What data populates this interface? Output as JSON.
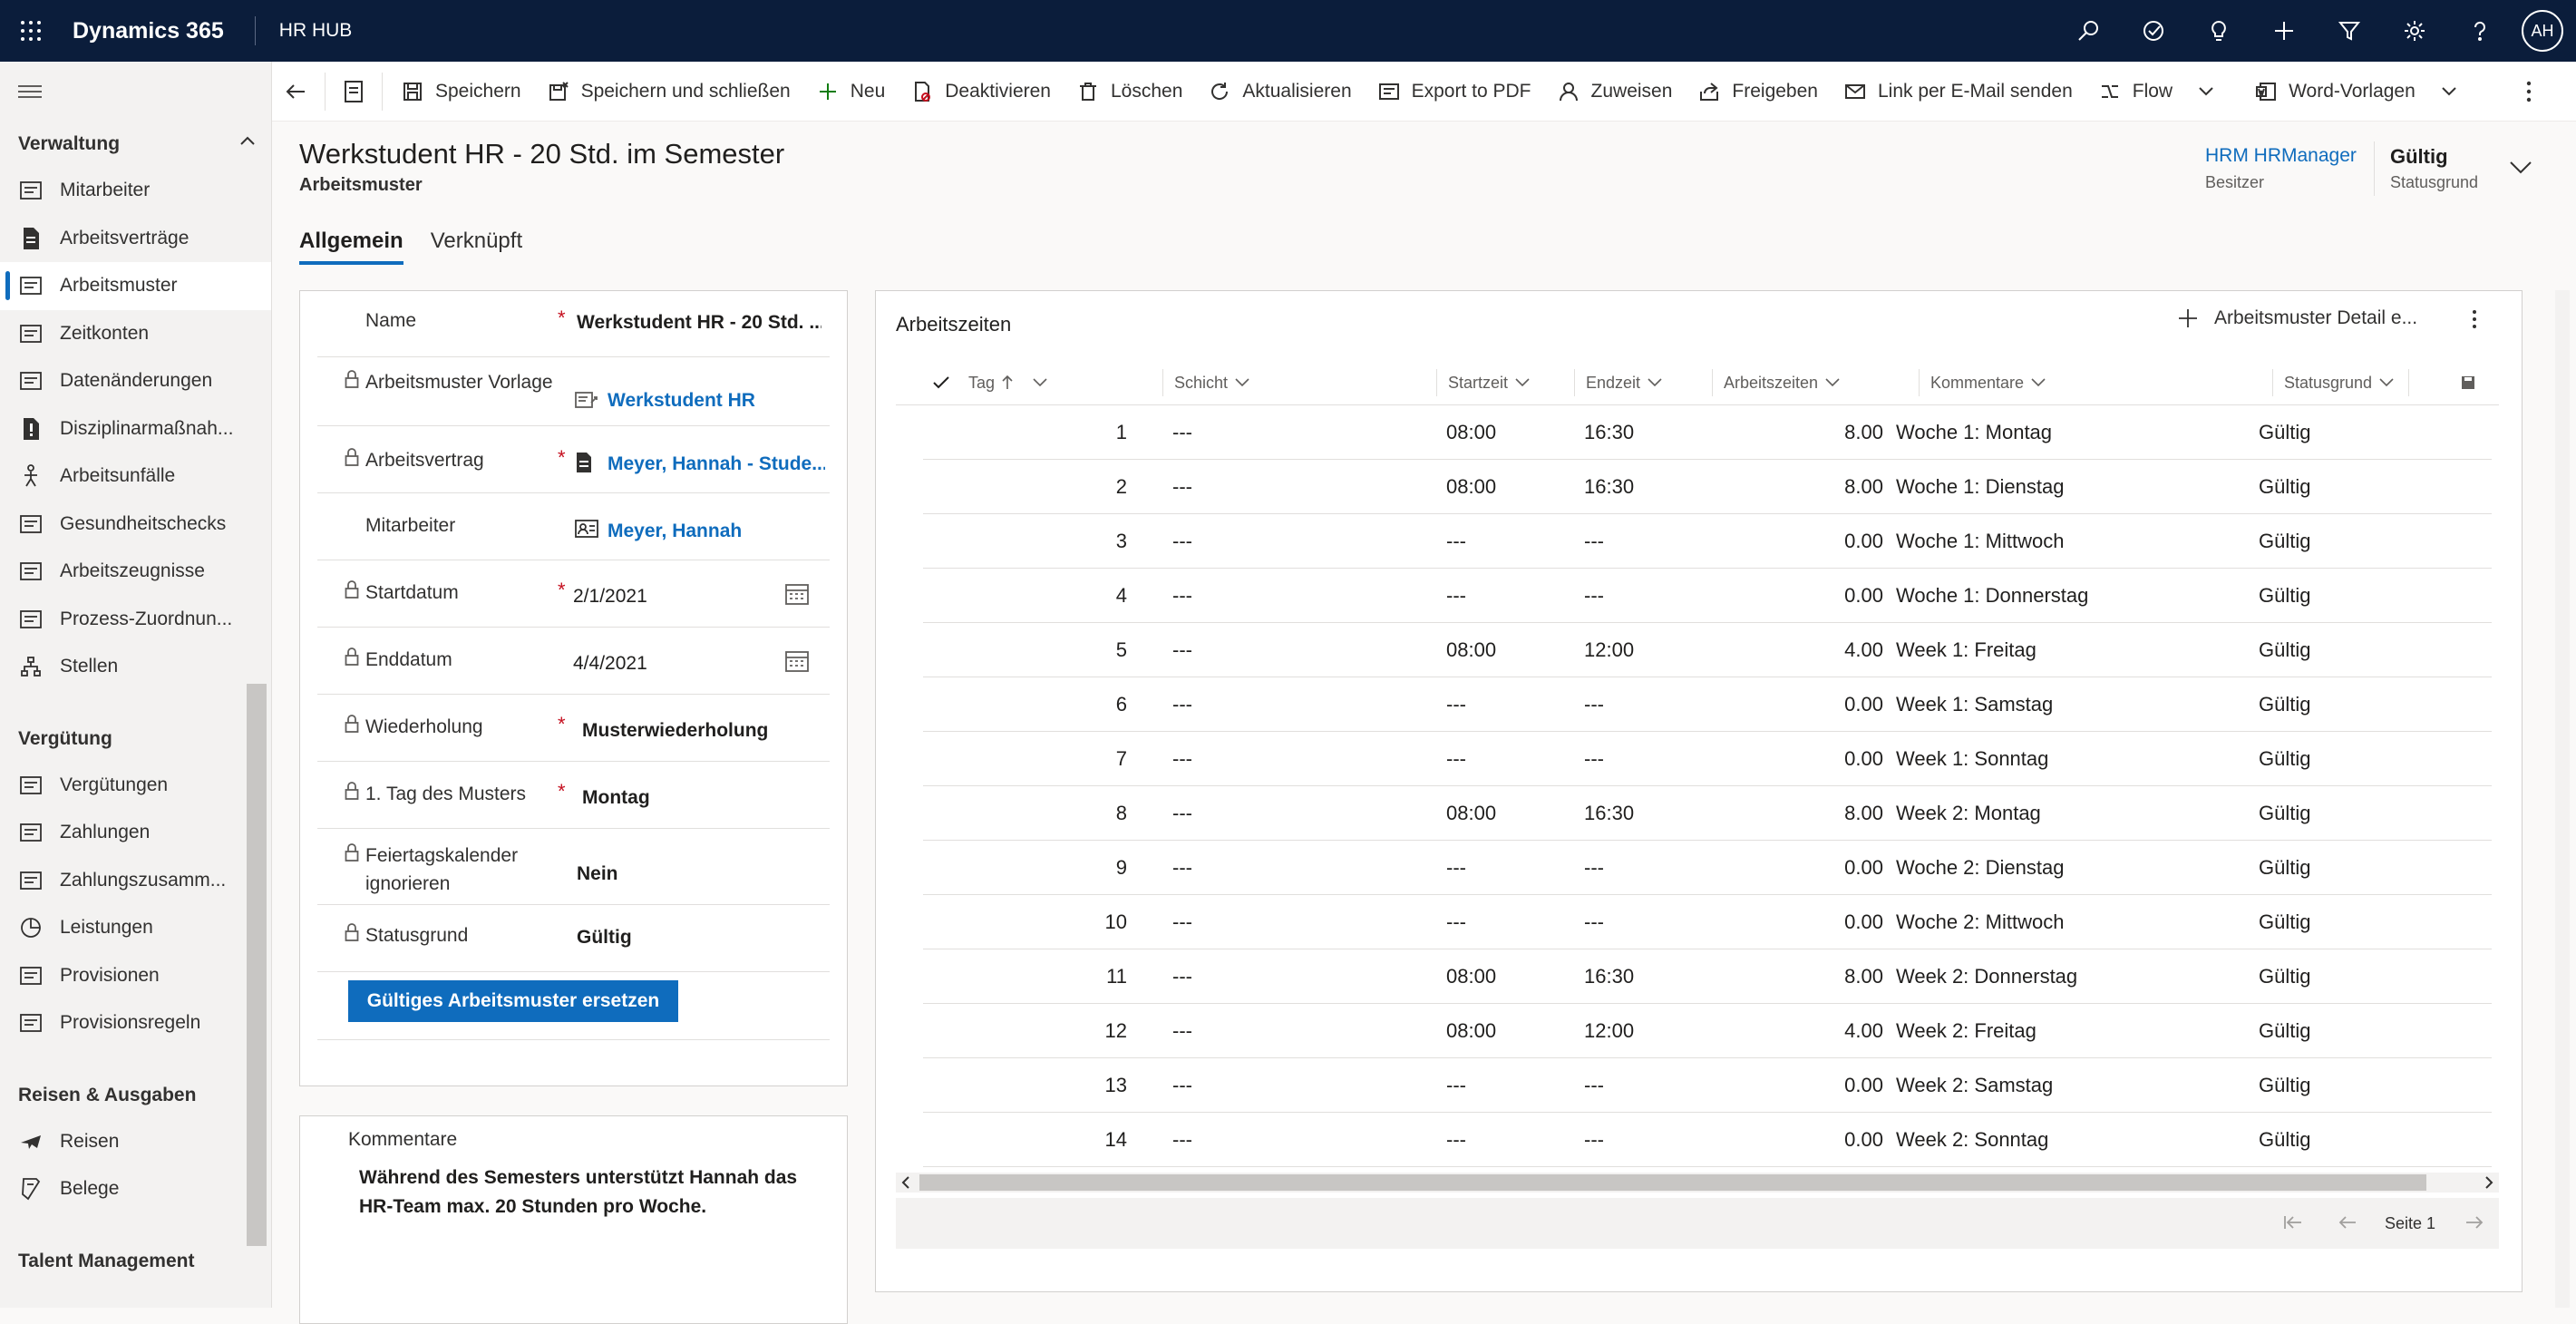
{
  "topbar": {
    "brand": "Dynamics 365",
    "app": "HR HUB",
    "avatar": "AH",
    "icons": [
      "search-icon",
      "task-icon",
      "lightbulb-icon",
      "plus-icon",
      "filter-icon",
      "gear-icon",
      "help-icon"
    ]
  },
  "sidebar": {
    "groups": [
      {
        "label": "Verwaltung",
        "items": [
          {
            "label": "Mitarbeiter",
            "icon": "contact-card-icon"
          },
          {
            "label": "Arbeitsverträge",
            "icon": "document-icon"
          },
          {
            "label": "Arbeitsmuster",
            "icon": "calendar-pattern-icon",
            "active": true
          },
          {
            "label": "Zeitkonten",
            "icon": "time-account-icon"
          },
          {
            "label": "Datenänderungen",
            "icon": "data-change-icon"
          },
          {
            "label": "Disziplinarmaßnah...",
            "icon": "alert-icon"
          },
          {
            "label": "Arbeitsunfälle",
            "icon": "accident-icon"
          },
          {
            "label": "Gesundheitschecks",
            "icon": "health-icon"
          },
          {
            "label": "Arbeitszeugnisse",
            "icon": "certificate-icon"
          },
          {
            "label": "Prozess-Zuordnun...",
            "icon": "process-icon"
          },
          {
            "label": "Stellen",
            "icon": "org-icon"
          }
        ]
      },
      {
        "label": "Vergütung",
        "items": [
          {
            "label": "Vergütungen",
            "icon": "money-icon"
          },
          {
            "label": "Zahlungen",
            "icon": "payment-icon"
          },
          {
            "label": "Zahlungszusamm...",
            "icon": "payment-summary-icon"
          },
          {
            "label": "Leistungen",
            "icon": "pie-icon"
          },
          {
            "label": "Provisionen",
            "icon": "commission-icon"
          },
          {
            "label": "Provisionsregeln",
            "icon": "rules-icon"
          }
        ]
      },
      {
        "label": "Reisen & Ausgaben",
        "items": [
          {
            "label": "Reisen",
            "icon": "plane-icon"
          },
          {
            "label": "Belege",
            "icon": "receipt-icon"
          }
        ]
      },
      {
        "label": "Talent Management",
        "items": []
      }
    ]
  },
  "commands": {
    "save": "Speichern",
    "save_close": "Speichern und schließen",
    "new": "Neu",
    "deactivate": "Deaktivieren",
    "delete": "Löschen",
    "refresh": "Aktualisieren",
    "export_pdf": "Export to PDF",
    "assign": "Zuweisen",
    "share": "Freigeben",
    "email_link": "Link per E-Mail senden",
    "flow": "Flow",
    "word_templates": "Word-Vorlagen"
  },
  "header": {
    "title": "Werkstudent HR - 20 Std. im Semester",
    "entity": "Arbeitsmuster",
    "owner_name": "HRM HRManager",
    "owner_label": "Besitzer",
    "status_value": "Gültig",
    "status_label": "Statusgrund"
  },
  "tabs": [
    "Allgemein",
    "Verknüpft"
  ],
  "form": {
    "name_label": "Name",
    "name_value": "Werkstudent HR - 20 Std. ...",
    "template_label": "Arbeitsmuster Vorlage",
    "template_value": "Werkstudent HR",
    "contract_label": "Arbeitsvertrag",
    "contract_value": "Meyer, Hannah  - Stude...",
    "employee_label": "Mitarbeiter",
    "employee_value": "Meyer, Hannah",
    "start_label": "Startdatum",
    "start_value": "2/1/2021",
    "end_label": "Enddatum",
    "end_value": "4/4/2021",
    "repeat_label": "Wiederholung",
    "repeat_value": "Musterwiederholung",
    "firstday_label": "1. Tag des Musters",
    "firstday_value": "Montag",
    "holiday_label": "Feiertagskalender ignorieren",
    "holiday_value": "Nein",
    "status_label": "Statusgrund",
    "status_value": "Gültig",
    "replace_button": "Gültiges Arbeitsmuster ersetzen"
  },
  "comments": {
    "label": "Kommentare",
    "text": "Während des Semesters unterstützt Hannah das HR-Team max. 20 Stunden pro Woche."
  },
  "grid": {
    "title": "Arbeitszeiten",
    "add_label": "Arbeitsmuster Detail e...",
    "columns": {
      "tag": "Tag",
      "schicht": "Schicht",
      "start": "Startzeit",
      "end": "Endzeit",
      "hours": "Arbeitszeiten",
      "comment": "Kommentare",
      "status": "Statusgrund"
    },
    "rows": [
      {
        "tag": "1",
        "schicht": "---",
        "start": "08:00",
        "end": "16:30",
        "hours": "8.00",
        "comment": "Woche 1: Montag",
        "status": "Gültig"
      },
      {
        "tag": "2",
        "schicht": "---",
        "start": "08:00",
        "end": "16:30",
        "hours": "8.00",
        "comment": "Woche 1: Dienstag",
        "status": "Gültig"
      },
      {
        "tag": "3",
        "schicht": "---",
        "start": "---",
        "end": "---",
        "hours": "0.00",
        "comment": "Woche 1: Mittwoch",
        "status": "Gültig"
      },
      {
        "tag": "4",
        "schicht": "---",
        "start": "---",
        "end": "---",
        "hours": "0.00",
        "comment": "Woche 1: Donnerstag",
        "status": "Gültig"
      },
      {
        "tag": "5",
        "schicht": "---",
        "start": "08:00",
        "end": "12:00",
        "hours": "4.00",
        "comment": "Week 1: Freitag",
        "status": "Gültig"
      },
      {
        "tag": "6",
        "schicht": "---",
        "start": "---",
        "end": "---",
        "hours": "0.00",
        "comment": "Week 1: Samstag",
        "status": "Gültig"
      },
      {
        "tag": "7",
        "schicht": "---",
        "start": "---",
        "end": "---",
        "hours": "0.00",
        "comment": "Week 1: Sonntag",
        "status": "Gültig"
      },
      {
        "tag": "8",
        "schicht": "---",
        "start": "08:00",
        "end": "16:30",
        "hours": "8.00",
        "comment": "Week 2: Montag",
        "status": "Gültig"
      },
      {
        "tag": "9",
        "schicht": "---",
        "start": "---",
        "end": "---",
        "hours": "0.00",
        "comment": "Woche 2: Dienstag",
        "status": "Gültig"
      },
      {
        "tag": "10",
        "schicht": "---",
        "start": "---",
        "end": "---",
        "hours": "0.00",
        "comment": "Woche 2: Mittwoch",
        "status": "Gültig"
      },
      {
        "tag": "11",
        "schicht": "---",
        "start": "08:00",
        "end": "16:30",
        "hours": "8.00",
        "comment": "Week 2: Donnerstag",
        "status": "Gültig"
      },
      {
        "tag": "12",
        "schicht": "---",
        "start": "08:00",
        "end": "12:00",
        "hours": "4.00",
        "comment": "Week 2: Freitag",
        "status": "Gültig"
      },
      {
        "tag": "13",
        "schicht": "---",
        "start": "---",
        "end": "---",
        "hours": "0.00",
        "comment": "Week 2: Samstag",
        "status": "Gültig"
      },
      {
        "tag": "14",
        "schicht": "---",
        "start": "---",
        "end": "---",
        "hours": "0.00",
        "comment": "Week 2: Sonntag",
        "status": "Gültig"
      }
    ],
    "page": "Seite 1"
  },
  "colors": {
    "accent": "#0f6cbd",
    "topbar": "#0b1d3b",
    "required": "#c50f1f"
  }
}
